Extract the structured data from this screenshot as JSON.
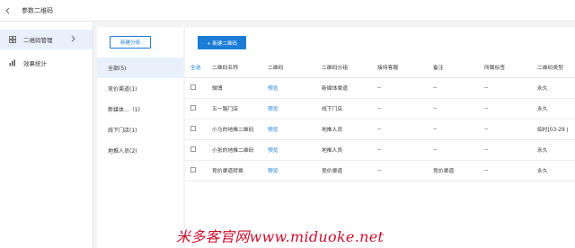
{
  "topbar": {
    "title": "参数二维码"
  },
  "sidebar": {
    "items": [
      {
        "label": "二维码管理",
        "active": true
      },
      {
        "label": "效果统计",
        "active": false
      }
    ]
  },
  "groups": {
    "new_button": "新建分组",
    "items": [
      {
        "label": "全部(5)",
        "active": true
      },
      {
        "label": "竞价渠道(1)"
      },
      {
        "label": "新媒体...（1)"
      },
      {
        "label": "线下门店(1)"
      },
      {
        "label": "地推人员(2)"
      }
    ]
  },
  "main": {
    "new_button": "+ 新建二维码",
    "columns": [
      "全选",
      "二维码名称",
      "二维码",
      "二维码分组",
      "接待客服",
      "备注",
      "所属标签",
      "二维码类型"
    ],
    "rows": [
      [
        "微博",
        "预览",
        "新媒体渠道",
        "--",
        "--",
        "--",
        "永久"
      ],
      [
        "五一路门店",
        "预览",
        "线下门店",
        "--",
        "--",
        "--",
        "永久"
      ],
      [
        "小马的地推二维码",
        "预览",
        "地推人员",
        "--",
        "--",
        "--",
        "临时[03-29 ("
      ],
      [
        "小张的地推二维码",
        "预览",
        "地推人员",
        "--",
        "--",
        "--",
        "永久"
      ],
      [
        "竞价渠道转换",
        "预览",
        "竞价渠道",
        "--",
        "竞价渠道",
        "--",
        "永久"
      ]
    ]
  },
  "watermark": "米多客官网www.miduoke.net",
  "colors": {
    "accent": "#1b7cd6",
    "watermark": "#c8102e",
    "active_bg": "#e8f1fb"
  }
}
